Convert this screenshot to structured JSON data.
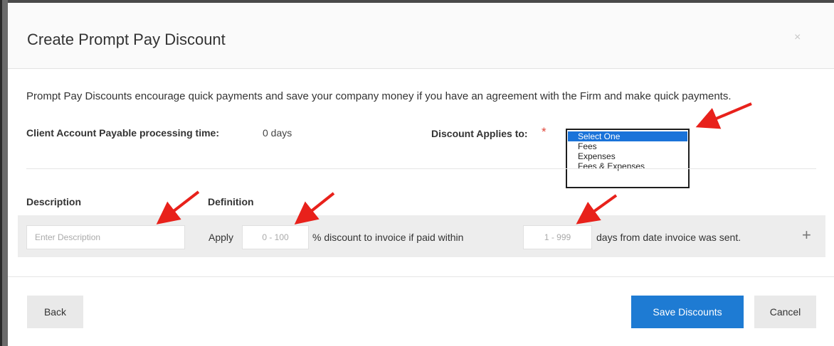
{
  "modal": {
    "title": "Create Prompt Pay Discount",
    "close_label": "×",
    "intro_text": "Prompt Pay Discounts encourage quick payments and save your company money if you have an agreement with the Firm and make quick payments.",
    "processing_time_label": "Client Account Payable processing time:",
    "processing_time_value": "0 days",
    "discount_applies_label": "Discount Applies to:",
    "required_marker": "*",
    "discount_options": [
      "Select One",
      "Fees",
      "Expenses",
      "Fees & Expenses"
    ],
    "selected_option": "Select One"
  },
  "table": {
    "col_description": "Description",
    "col_definition": "Definition",
    "row": {
      "description_placeholder": "Enter Description",
      "apply_text": "Apply",
      "percent_placeholder": "0 - 100",
      "percent_text": "% discount to invoice if paid within",
      "days_placeholder": "1 - 999",
      "days_text": "days from date invoice was sent.",
      "add_label": "+"
    }
  },
  "footer": {
    "back_label": "Back",
    "save_label": "Save Discounts",
    "cancel_label": "Cancel"
  },
  "annotation": {
    "arrow_color": "#e8211b"
  }
}
